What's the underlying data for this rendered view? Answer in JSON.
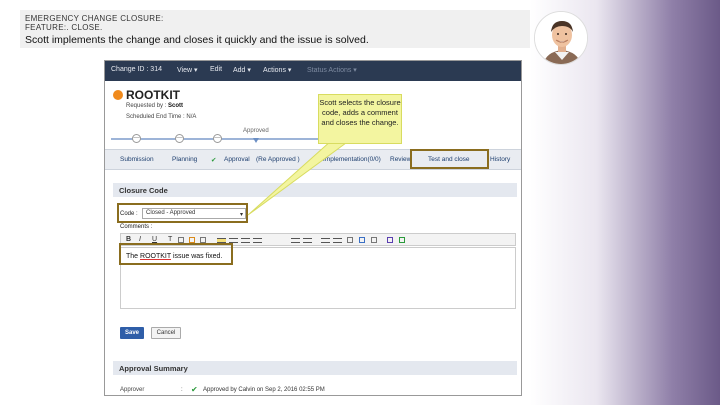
{
  "header": {
    "line1": "EMERGENCY CHANGE CLOSURE:",
    "line2": "FEATURE:. CLOSE.",
    "line3": "Scott implements the change and closes it quickly and the issue is solved."
  },
  "app": {
    "topbar": {
      "change_id": "Change ID : 314",
      "view": "View ▾",
      "edit": "Edit",
      "add": "Add ▾",
      "actions": "Actions ▾",
      "status_actions": "Status Actions ▾"
    },
    "title": "ROOTKIT",
    "requested_by": "Requested by : ",
    "requester": "Scott",
    "scheduled_end": "Scheduled End Time : N/A",
    "progress_label": "Approved",
    "progress_nodes": [
      "—",
      "—",
      "—",
      "—"
    ],
    "tabs": {
      "submission": "Submission",
      "planning": "Planning",
      "approval": "Approval",
      "approval_status": "(Re Approved )",
      "implementation": "Implementation(0/0)",
      "review": "Review",
      "test_close": "Test and close",
      "history": "History"
    },
    "closure_section": "Closure Code",
    "code_label": "Code :",
    "code_value": "Closed - Approved",
    "comments_label": "Comments :",
    "toolbar": {
      "bold": "B",
      "italic": "I",
      "underline": "U"
    },
    "comment_text": {
      "prefix": "The ",
      "highlight": "ROOTKIT",
      "suffix": " issue was fixed."
    },
    "save": "Save",
    "cancel": "Cancel",
    "approval_section": "Approval Summary",
    "approval_row": {
      "label": "Approver",
      "colon": ":",
      "check": "✔",
      "text": "Approved by Calvin on Sep 2, 2016 02:55 PM"
    }
  },
  "callout": {
    "text": "Scott selects the closure code, adds a comment and closes the change."
  },
  "colors": {
    "topbar": "#2b3a52",
    "highlight_border": "#8a6d1f",
    "callout_bg": "#f3f5a0",
    "save_button": "#2f5ea8",
    "side_strip": "#6b5a88"
  }
}
